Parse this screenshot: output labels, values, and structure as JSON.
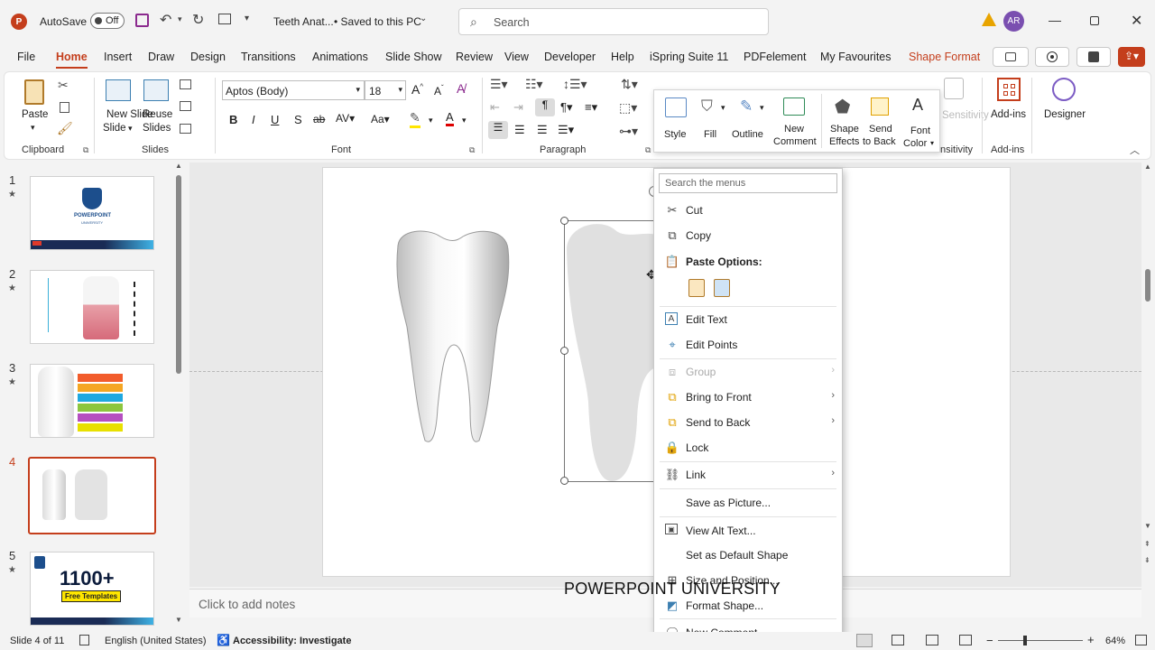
{
  "titlebar": {
    "autosave_label": "AutoSave",
    "autosave_state": "Off",
    "doc_title": "Teeth Anat...",
    "save_status": "• Saved to this PC",
    "search_placeholder": "Search",
    "user_initials": "AR"
  },
  "menu": {
    "tabs": [
      "File",
      "Home",
      "Insert",
      "Draw",
      "Design",
      "Transitions",
      "Animations",
      "Slide Show",
      "Review",
      "View",
      "Developer",
      "Help",
      "iSpring Suite 11",
      "PDFelement",
      "My Favourites",
      "Shape Format"
    ],
    "active": "Home"
  },
  "ribbon": {
    "clipboard": {
      "paste": "Paste",
      "group": "Clipboard"
    },
    "slides": {
      "new_slide": "New Slide",
      "new_slide_2": "Slide",
      "reuse": "Reuse",
      "reuse_2": "Slides",
      "group": "Slides"
    },
    "font": {
      "family": "Aptos (Body)",
      "size": "18",
      "group": "Font"
    },
    "paragraph": {
      "group": "Paragraph"
    },
    "sensitivity": {
      "label": "Sensitivity",
      "short": "nsitivity"
    },
    "addins": {
      "label": "Add-ins",
      "group": "Add-ins"
    },
    "designer": {
      "label": "Designer"
    }
  },
  "mini_toolbar": {
    "style": "Style",
    "fill": "Fill",
    "outline": "Outline",
    "new_comment_1": "New",
    "new_comment_2": "Comment",
    "shape_effects_1": "Shape",
    "shape_effects_2": "Effects",
    "send_back_1": "Send",
    "send_back_2": "to Back",
    "font_color_1": "Font",
    "font_color_2": "Color"
  },
  "thumbnails": [
    {
      "num": "1",
      "star": "★"
    },
    {
      "num": "2",
      "star": "★"
    },
    {
      "num": "3",
      "star": "★"
    },
    {
      "num": "4",
      "star": ""
    },
    {
      "num": "5",
      "star": "★"
    }
  ],
  "thumb_texts": {
    "t1_title": "POWERPOINT",
    "t1_sub": "UNIVERSITY",
    "t5_big": "1100+",
    "t5_sub": "Free Templates"
  },
  "context_menu": {
    "search_placeholder": "Search the menus",
    "cut": "Cut",
    "copy": "Copy",
    "paste_options": "Paste Options:",
    "edit_text": "Edit Text",
    "edit_points": "Edit Points",
    "group": "Group",
    "bring_front": "Bring to Front",
    "send_back": "Send to Back",
    "lock": "Lock",
    "link": "Link",
    "save_picture": "Save as Picture...",
    "alt_text": "View Alt Text...",
    "default_shape": "Set as Default Shape",
    "size_position": "Size and Position...",
    "format_shape": "Format Shape...",
    "new_comment": "New Comment"
  },
  "watermark": "POWERPOINT UNIVERSITY",
  "notes_placeholder": "Click to add notes",
  "status": {
    "slide": "Slide 4 of 11",
    "language": "English (United States)",
    "accessibility": "Accessibility: Investigate",
    "zoom": "64%"
  },
  "colors": {
    "accent": "#c43e1c",
    "shape_format": "#c43e1c"
  }
}
